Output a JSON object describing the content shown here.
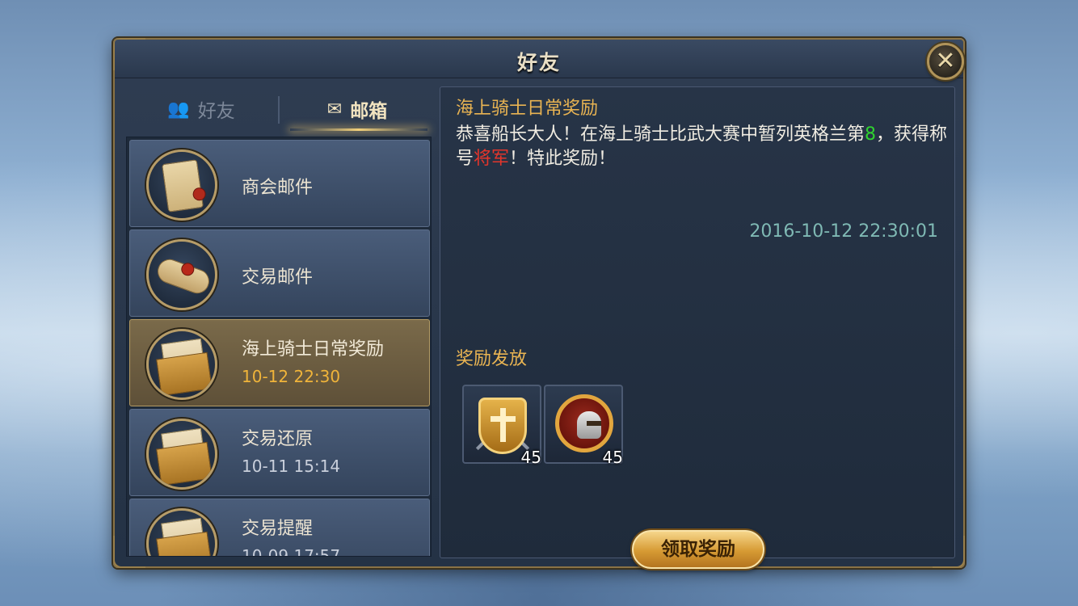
{
  "dialog": {
    "title": "好友",
    "close_icon": "✕"
  },
  "tabs": [
    {
      "label": "好友",
      "icon": "friends-icon",
      "selected": false
    },
    {
      "label": "邮箱",
      "icon": "mail-icon",
      "selected": true
    }
  ],
  "mail_list": [
    {
      "title": "商会邮件",
      "time": "",
      "icon": "scroll-icon"
    },
    {
      "title": "交易邮件",
      "time": "",
      "icon": "rolled-scroll-icon"
    },
    {
      "title": "海上骑士日常奖励",
      "time": "10-12  22:30",
      "icon": "envelope-icon",
      "selected": true
    },
    {
      "title": "交易还原",
      "time": "10-11  15:14",
      "icon": "envelope-icon"
    },
    {
      "title": "交易提醒",
      "time": "10-09  17:57",
      "icon": "envelope-icon"
    }
  ],
  "message": {
    "title": "海上骑士日常奖励",
    "body_part1": "恭喜船长大人！在海上骑士比武大赛中暂列英格兰第",
    "rank": "8",
    "body_part2": "，获得称号",
    "honor": "将军",
    "body_part3": "！特此奖励！",
    "date": "2016-10-12  22:30:01"
  },
  "rewards": {
    "label": "奖励发放",
    "items": [
      {
        "icon": "shield-swords-icon",
        "quantity": "45"
      },
      {
        "icon": "helmet-medal-icon",
        "quantity": "45"
      }
    ],
    "claim_label": "领取奖励"
  },
  "colors": {
    "accent_gold": "#e9b452",
    "rank_green": "#2fd32f",
    "honor_red": "#e5352b",
    "date_teal": "#7fb9b4"
  }
}
